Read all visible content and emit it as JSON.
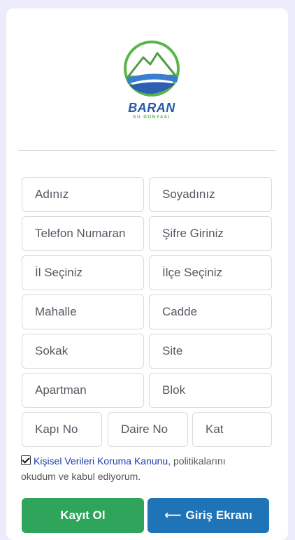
{
  "brand": {
    "name": "BARAN",
    "tagline": "SU DÜNYASI"
  },
  "form": {
    "first_name_placeholder": "Adınız",
    "last_name_placeholder": "Soyadınız",
    "phone_placeholder": "Telefon Numaran",
    "password_placeholder": "Şifre Giriniz",
    "province_placeholder": "İl Seçiniz",
    "district_placeholder": "İlçe Seçiniz",
    "neighborhood_placeholder": "Mahalle",
    "street_placeholder": "Cadde",
    "alley_placeholder": "Sokak",
    "site_placeholder": "Site",
    "apartment_placeholder": "Apartman",
    "block_placeholder": "Blok",
    "door_no_placeholder": "Kapı No",
    "flat_no_placeholder": "Daire No",
    "floor_placeholder": "Kat"
  },
  "consent": {
    "checked": true,
    "link_text": "Kişisel Verileri Koruma Kanunu",
    "text": ", politikalarını okudum ve kabul ediyorum."
  },
  "buttons": {
    "register_label": "Kayıt Ol",
    "login_arrow": "⟵",
    "login_label": "Giriş Ekranı"
  },
  "colors": {
    "background": "#ecebfb",
    "register_button": "#2ea55b",
    "login_button": "#1f73b7",
    "link": "#1a3fb0"
  }
}
